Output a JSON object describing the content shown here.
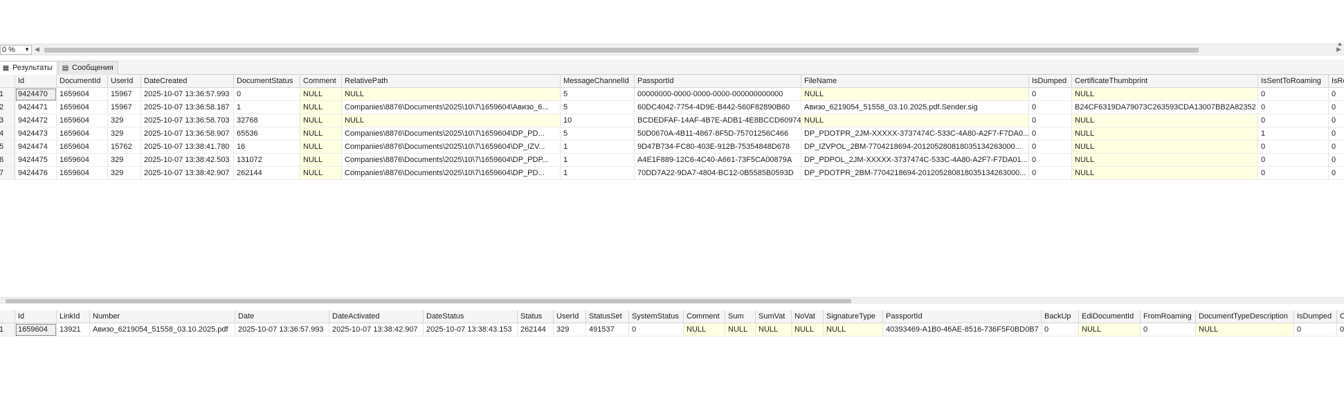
{
  "zoom": "0 %",
  "tabs": [
    "Результаты",
    "Сообщения"
  ],
  "grid1": {
    "columns": [
      {
        "name": "",
        "w": 24
      },
      {
        "name": "Id",
        "w": 60
      },
      {
        "name": "DocumentId",
        "w": 74
      },
      {
        "name": "UserId",
        "w": 48
      },
      {
        "name": "DateCreated",
        "w": 134
      },
      {
        "name": "DocumentStatus",
        "w": 96
      },
      {
        "name": "Comment",
        "w": 60
      },
      {
        "name": "RelativePath",
        "w": 316
      },
      {
        "name": "MessageChannelId",
        "w": 107
      },
      {
        "name": "PassportId",
        "w": 241
      },
      {
        "name": "FileName",
        "w": 329
      },
      {
        "name": "IsDumped",
        "w": 62
      },
      {
        "name": "CertificateThumbprint",
        "w": 269
      },
      {
        "name": "IsSentToRoaming",
        "w": 102
      },
      {
        "name": "IsRe",
        "w": 30
      }
    ],
    "rows": [
      [
        "1",
        "9424470",
        "1659604",
        "15967",
        "2025-10-07 13:36:57.993",
        "0",
        "NULL",
        "NULL",
        "5",
        "00000000-0000-0000-0000-000000000000",
        "NULL",
        "0",
        "NULL",
        "0",
        "0"
      ],
      [
        "2",
        "9424471",
        "1659604",
        "15967",
        "2025-10-07 13:36:58.187",
        "1",
        "NULL",
        "Companies\\8876\\Documents\\2025\\10\\7\\1659604\\Авизо_6...",
        "5",
        "60DC4042-7754-4D9E-B442-560F82890B60",
        "Авизо_6219054_51558_03.10.2025.pdf.Sender.sig",
        "0",
        "B24CF6319DA79073C263593CDA13007BB2A82352",
        "0",
        "0"
      ],
      [
        "3",
        "9424472",
        "1659604",
        "329",
        "2025-10-07 13:36:58.703",
        "32768",
        "NULL",
        "NULL",
        "10",
        "BCDEDFAF-14AF-4B7E-ADB1-4E8BCCD60974",
        "NULL",
        "0",
        "NULL",
        "0",
        "0"
      ],
      [
        "4",
        "9424473",
        "1659604",
        "329",
        "2025-10-07 13:36:58.907",
        "65536",
        "NULL",
        "Companies\\8876\\Documents\\2025\\10\\7\\1659604\\DP_PD...",
        "5",
        "50D0670A-4B11-4867-8F5D-75701256C466",
        "DP_PDOTPR_2JM-XXXXX-3737474C-533C-4A80-A2F7-F7DA0...",
        "0",
        "NULL",
        "1",
        "0"
      ],
      [
        "5",
        "9424474",
        "1659604",
        "15762",
        "2025-10-07 13:38:41.780",
        "16",
        "NULL",
        "Companies\\8876\\Documents\\2025\\10\\7\\1659604\\DP_IZV...",
        "1",
        "9D47B734-FC80-403E-912B-75354848D678",
        "DP_IZVPOL_2BM-7704218694-201205280818035134263000...",
        "0",
        "NULL",
        "0",
        "0"
      ],
      [
        "6",
        "9424475",
        "1659604",
        "329",
        "2025-10-07 13:38:42.503",
        "131072",
        "NULL",
        "Companies\\8876\\Documents\\2025\\10\\7\\1659604\\DP_PDP...",
        "1",
        "A4E1F889-12C6-4C40-A661-73F5CA00879A",
        "DP_PDPOL_2JM-XXXXX-3737474C-533C-4A80-A2F7-F7DA01...",
        "0",
        "NULL",
        "0",
        "0"
      ],
      [
        "7",
        "9424476",
        "1659604",
        "329",
        "2025-10-07 13:38:42.907",
        "262144",
        "NULL",
        "Companies\\8876\\Documents\\2025\\10\\7\\1659604\\DP_PD...",
        "1",
        "70DD7A22-9DA7-4804-BC12-0B5585B0593D",
        "DP_PDOTPR_2BM-7704218694-201205280818035134263000...",
        "0",
        "NULL",
        "0",
        "0"
      ]
    ]
  },
  "grid2": {
    "columns": [
      {
        "name": "",
        "w": 24
      },
      {
        "name": "Id",
        "w": 60
      },
      {
        "name": "LinkId",
        "w": 48
      },
      {
        "name": "Number",
        "w": 210
      },
      {
        "name": "Date",
        "w": 136
      },
      {
        "name": "DateActivated",
        "w": 136
      },
      {
        "name": "DateStatus",
        "w": 136
      },
      {
        "name": "Status",
        "w": 52
      },
      {
        "name": "UserId",
        "w": 47
      },
      {
        "name": "StatusSet",
        "w": 62
      },
      {
        "name": "SystemStatus",
        "w": 79
      },
      {
        "name": "Comment",
        "w": 60
      },
      {
        "name": "Sum",
        "w": 44
      },
      {
        "name": "SumVat",
        "w": 52
      },
      {
        "name": "NoVat",
        "w": 46
      },
      {
        "name": "SignatureType",
        "w": 86
      },
      {
        "name": "PassportId",
        "w": 229
      },
      {
        "name": "BackUp",
        "w": 54
      },
      {
        "name": "EdiDocumentId",
        "w": 89
      },
      {
        "name": "FromRoaming",
        "w": 80
      },
      {
        "name": "DocumentTypeDescription",
        "w": 142
      },
      {
        "name": "IsDumped",
        "w": 62
      },
      {
        "name": "C",
        "w": 30
      }
    ],
    "rows": [
      [
        "1",
        "1659604",
        "13921",
        "Авизо_6219054_51558_03.10.2025.pdf",
        "2025-10-07 13:36:57.993",
        "2025-10-07 13:38:42.907",
        "2025-10-07 13:38:43.153",
        "262144",
        "329",
        "491537",
        "0",
        "NULL",
        "NULL",
        "NULL",
        "NULL",
        "NULL",
        "40393469-A1B0-46AE-8516-736F5F0BD0B7",
        "0",
        "NULL",
        "0",
        "NULL",
        "0",
        "0"
      ]
    ]
  }
}
